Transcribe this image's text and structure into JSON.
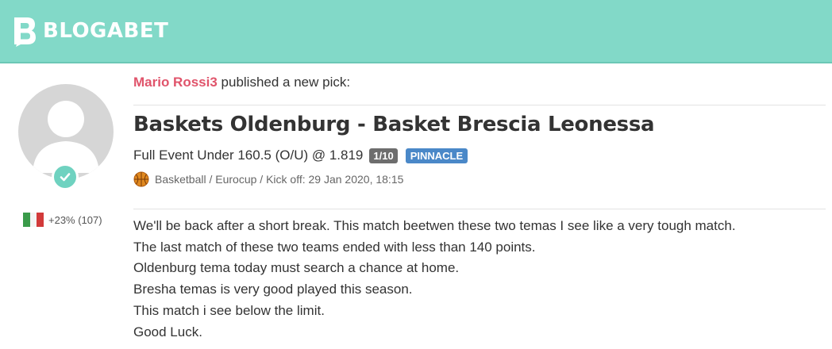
{
  "header": {
    "brand": "BLOGABET",
    "brand_color": "#82d9c8",
    "logo_icon": "blogabet-logo-icon"
  },
  "user": {
    "avatar_icon": "default-avatar-icon",
    "verified_icon": "checkmark-icon",
    "country_flag": "italy-flag-icon",
    "yield": "+23% (107)"
  },
  "post": {
    "author": "Mario Rossi3",
    "action_text": " published a new pick:",
    "event_title": "Baskets Oldenburg - Basket Brescia Leonessa",
    "pick": "Full Event Under 160.5 (O/U) @ 1.819",
    "stake": "1/10",
    "bookmaker": "PINNACLE",
    "sport_icon": "basketball-icon",
    "meta": "Basketball / Eurocup / Kick off: 29 Jan 2020, 18:15",
    "analysis": [
      "We'll be back after a short break. This match beetwen these two temas I see like a very tough match.",
      "The last match of these two teams ended with less than 140 points.",
      "Oldenburg tema today must search a chance at home.",
      "Bresha temas is very good played this season.",
      "This match i see below the limit.",
      "Good Luck."
    ]
  },
  "colors": {
    "author": "#e0546b",
    "stake_badge": "#6d6d6d",
    "bookmaker_badge": "#4a88c8",
    "verified": "#6fd2c0"
  }
}
